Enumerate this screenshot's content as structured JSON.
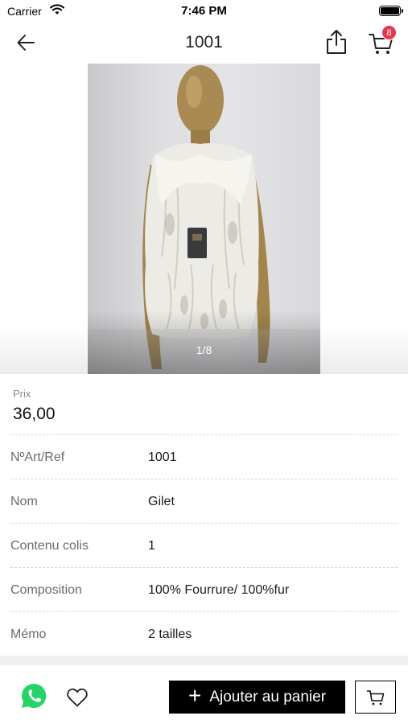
{
  "status_bar": {
    "carrier": "Carrier",
    "time": "7:46 PM"
  },
  "nav": {
    "title": "1001",
    "cart_count": "8"
  },
  "gallery": {
    "page_indicator": "1/8"
  },
  "price": {
    "label": "Prix",
    "value": "36,00"
  },
  "attributes": [
    {
      "label": "NºArt/Ref",
      "value": "1001"
    },
    {
      "label": "Nom",
      "value": "Gilet"
    },
    {
      "label": "Contenu colis",
      "value": "1"
    },
    {
      "label": "Composition",
      "value": "100% Fourrure/ 100%fur"
    },
    {
      "label": "Mémo",
      "value": "2 tailles"
    }
  ],
  "bottom_bar": {
    "add_to_cart_label": "Ajouter au panier"
  },
  "colors": {
    "badge": "#e5394f",
    "whatsapp": "#25d366",
    "primary_button": "#000000"
  }
}
